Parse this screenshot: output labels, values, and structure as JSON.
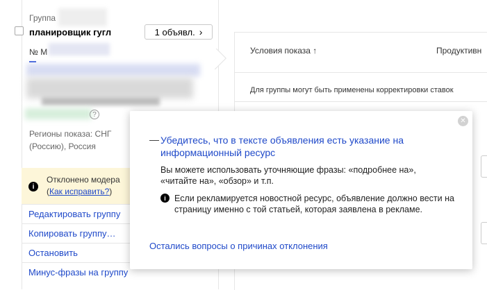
{
  "group": {
    "caption": "Группа",
    "name": "планировщик гугл",
    "ads_count_label": "1 объявл.",
    "ads_count_chevron": "›",
    "ad_number_prefix": "№ М",
    "help_glyph": "?",
    "regions_text": "Регионы показа: СНГ (Россию), Россия"
  },
  "warning": {
    "icon": "info-icon",
    "text": "Отклонено модера",
    "open_paren": "(",
    "link": "Как исправить?",
    "close_paren": ")"
  },
  "actions": [
    {
      "label": "Редактировать группу"
    },
    {
      "label": "Копировать группу…"
    },
    {
      "label": "Остановить"
    },
    {
      "label": "Минус-фразы на группу"
    }
  ],
  "table": {
    "col1": "Условия показа ↑",
    "col2": "Продуктивн",
    "note": "Для группы могут быть применены корректировки ставок"
  },
  "popup": {
    "close_glyph": "✕",
    "dash": "—",
    "title": "Убедитесь, что в тексте объявления есть указание на информационный ресурс",
    "body": "Вы можете использовать уточняющие фразы: «подробнее на», «читайте на», «обзор» и т.п.",
    "info_glyph": "i",
    "note": "Если рекламируется новостной ресурс, объявление должно вести на страницу именно с той статьей, которая заявлена в рекламе.",
    "link": "Остались вопросы о причинах отклонения"
  },
  "colors": {
    "link": "#1f49c9",
    "warning_bg": "#fdf6d9"
  }
}
